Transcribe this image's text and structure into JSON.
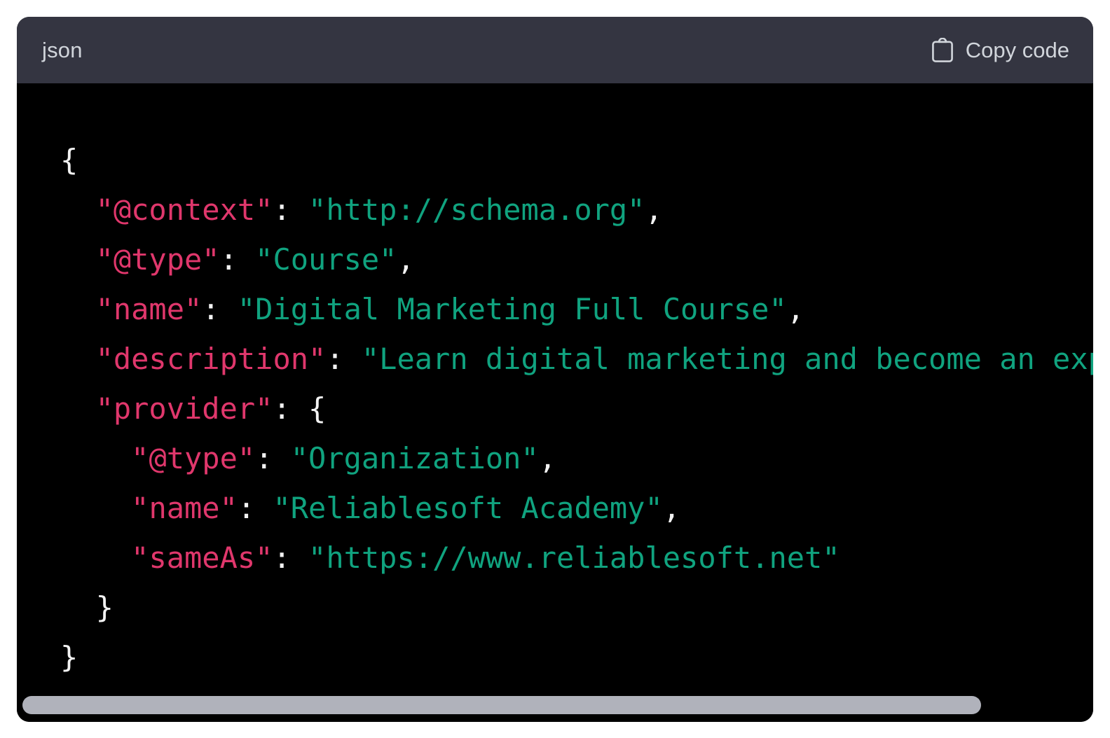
{
  "code_block": {
    "language_label": "json",
    "copy_button_label": "Copy code",
    "copy_icon": "clipboard-icon",
    "colors": {
      "header_background": "#343541",
      "body_background": "#000000",
      "key": "#e0376c",
      "string": "#10a37f",
      "punctuation": "#f2f2f2",
      "label_text": "#d1d5db",
      "scrollbar_thumb": "#b0b2bb"
    },
    "lines": [
      {
        "indent": "",
        "segments": [
          {
            "t": "{",
            "c": "punct"
          }
        ]
      },
      {
        "indent": "  ",
        "segments": [
          {
            "t": "\"@context\"",
            "c": "key"
          },
          {
            "t": ": ",
            "c": "punct"
          },
          {
            "t": "\"http://schema.org\"",
            "c": "str"
          },
          {
            "t": ",",
            "c": "punct"
          }
        ]
      },
      {
        "indent": "  ",
        "segments": [
          {
            "t": "\"@type\"",
            "c": "key"
          },
          {
            "t": ": ",
            "c": "punct"
          },
          {
            "t": "\"Course\"",
            "c": "str"
          },
          {
            "t": ",",
            "c": "punct"
          }
        ]
      },
      {
        "indent": "  ",
        "segments": [
          {
            "t": "\"name\"",
            "c": "key"
          },
          {
            "t": ": ",
            "c": "punct"
          },
          {
            "t": "\"Digital Marketing Full Course\"",
            "c": "str"
          },
          {
            "t": ",",
            "c": "punct"
          }
        ]
      },
      {
        "indent": "  ",
        "segments": [
          {
            "t": "\"description\"",
            "c": "key"
          },
          {
            "t": ": ",
            "c": "punct"
          },
          {
            "t": "\"Learn digital marketing and become an expert\"",
            "c": "str"
          },
          {
            "t": ",",
            "c": "punct"
          }
        ]
      },
      {
        "indent": "  ",
        "segments": [
          {
            "t": "\"provider\"",
            "c": "key"
          },
          {
            "t": ": ",
            "c": "punct"
          },
          {
            "t": "{",
            "c": "punct"
          }
        ]
      },
      {
        "indent": "    ",
        "segments": [
          {
            "t": "\"@type\"",
            "c": "key"
          },
          {
            "t": ": ",
            "c": "punct"
          },
          {
            "t": "\"Organization\"",
            "c": "str"
          },
          {
            "t": ",",
            "c": "punct"
          }
        ]
      },
      {
        "indent": "    ",
        "segments": [
          {
            "t": "\"name\"",
            "c": "key"
          },
          {
            "t": ": ",
            "c": "punct"
          },
          {
            "t": "\"Reliablesoft Academy\"",
            "c": "str"
          },
          {
            "t": ",",
            "c": "punct"
          }
        ]
      },
      {
        "indent": "    ",
        "segments": [
          {
            "t": "\"sameAs\"",
            "c": "key"
          },
          {
            "t": ": ",
            "c": "punct"
          },
          {
            "t": "\"https://www.reliablesoft.net\"",
            "c": "str"
          }
        ]
      },
      {
        "indent": "  ",
        "segments": [
          {
            "t": "}",
            "c": "punct"
          }
        ]
      },
      {
        "indent": "",
        "segments": [
          {
            "t": "}",
            "c": "punct"
          }
        ]
      }
    ]
  }
}
